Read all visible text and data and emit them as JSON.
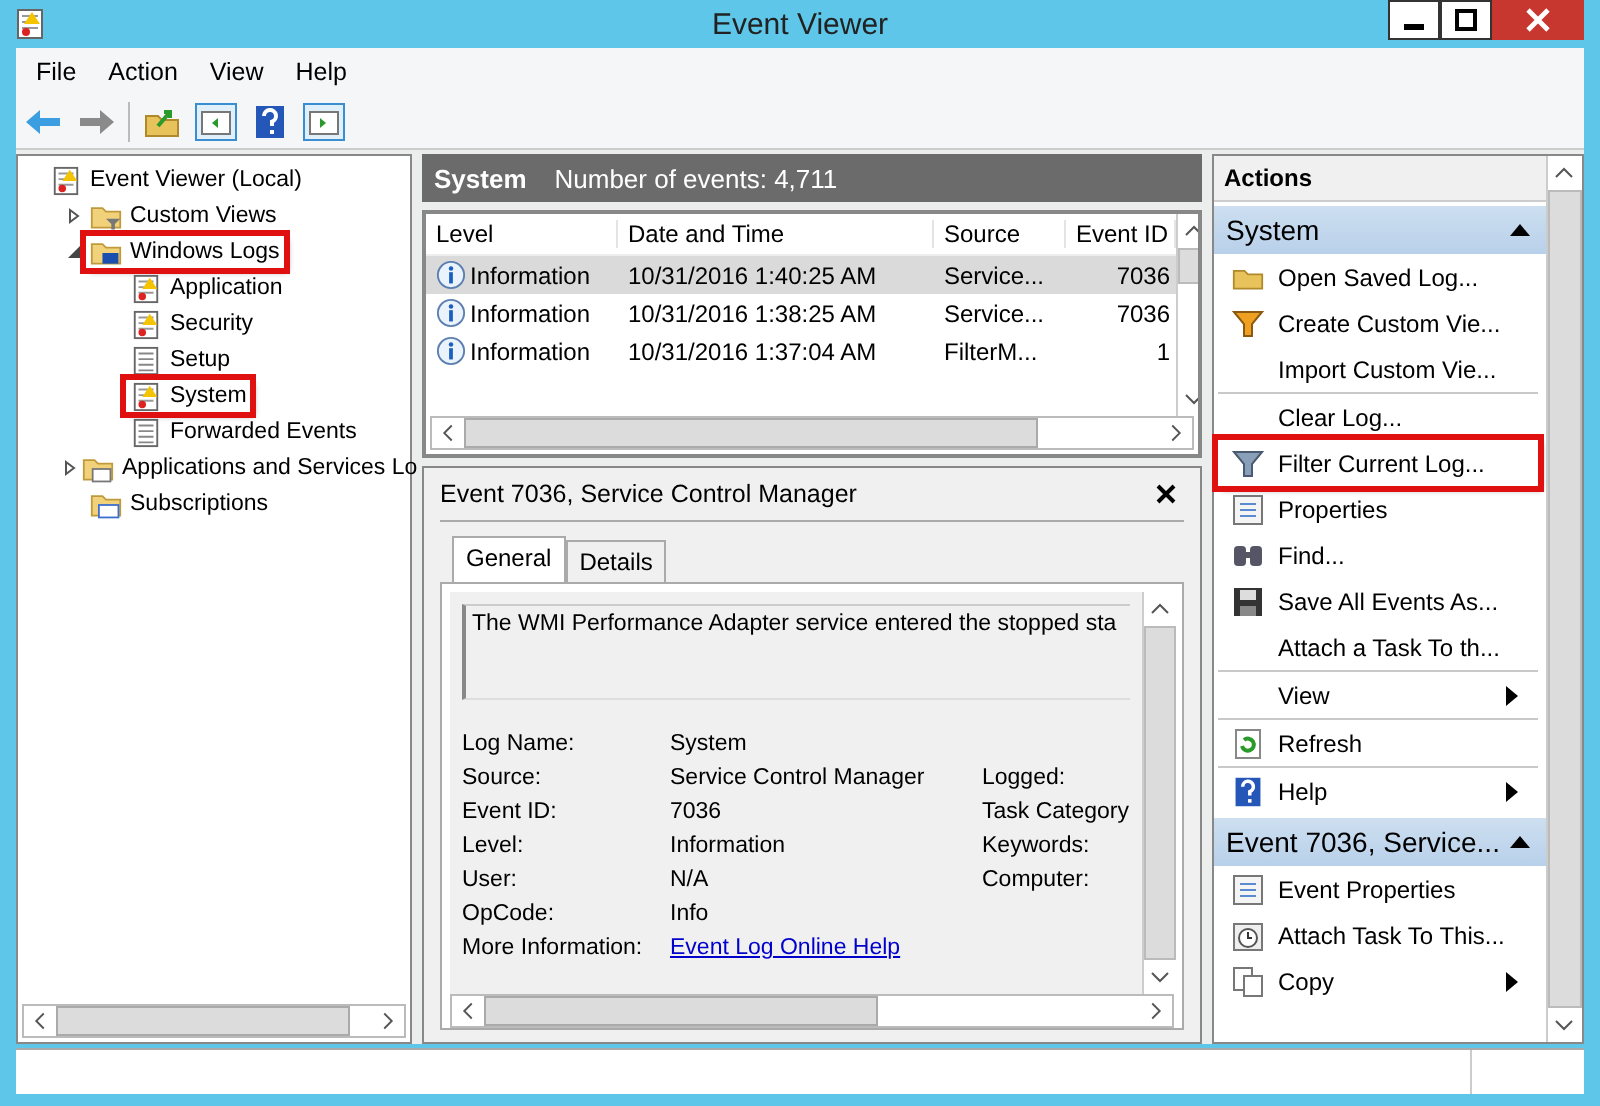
{
  "window": {
    "title": "Event Viewer"
  },
  "menu": [
    "File",
    "Action",
    "View",
    "Help"
  ],
  "tree": [
    {
      "label": "Event Viewer (Local)",
      "kind": "root",
      "highlighted": false,
      "children": [
        {
          "label": "Custom Views",
          "kind": "filter-folder",
          "expanded": false,
          "highlighted": false
        },
        {
          "label": "Windows Logs",
          "kind": "logs-folder",
          "expanded": true,
          "highlighted": true,
          "children": [
            {
              "label": "Application",
              "kind": "log",
              "highlighted": false
            },
            {
              "label": "Security",
              "kind": "log",
              "highlighted": false
            },
            {
              "label": "Setup",
              "kind": "plain-log",
              "highlighted": false
            },
            {
              "label": "System",
              "kind": "log",
              "highlighted": true
            },
            {
              "label": "Forwarded Events",
              "kind": "plain-log",
              "highlighted": false
            }
          ]
        },
        {
          "label": "Applications and Services Lo",
          "kind": "folder",
          "expanded": false,
          "highlighted": false
        },
        {
          "label": "Subscriptions",
          "kind": "subscriptions",
          "highlighted": false
        }
      ]
    }
  ],
  "log_header": {
    "title": "System",
    "count": "Number of events: 4,711"
  },
  "events": {
    "columns": [
      "Level",
      "Date and Time",
      "Source",
      "Event ID"
    ],
    "rows": [
      {
        "level": "Information",
        "date": "10/31/2016 1:40:25 AM",
        "source": "Service...",
        "event_id": "7036",
        "selected": true
      },
      {
        "level": "Information",
        "date": "10/31/2016 1:38:25 AM",
        "source": "Service...",
        "event_id": "7036",
        "selected": false
      },
      {
        "level": "Information",
        "date": "10/31/2016 1:37:04 AM",
        "source": "FilterM...",
        "event_id": "1",
        "selected": false
      }
    ]
  },
  "detail": {
    "title": "Event 7036, Service Control Manager",
    "tabs": [
      {
        "label": "General",
        "selected": true
      },
      {
        "label": "Details",
        "selected": false
      }
    ],
    "description": "The WMI Performance Adapter service entered the stopped sta",
    "fields": [
      {
        "label": "Log Name:",
        "value": "System"
      },
      {
        "label": "Source:",
        "value": "Service Control Manager"
      },
      {
        "label": "Event ID:",
        "value": "7036"
      },
      {
        "label": "Level:",
        "value": "Information"
      },
      {
        "label": "User:",
        "value": "N/A"
      },
      {
        "label": "OpCode:",
        "value": "Info"
      }
    ],
    "right_labels": [
      "Logged:",
      "Task Category",
      "Keywords:",
      "Computer:"
    ],
    "more_info": {
      "label": "More Information:",
      "link": "Event Log Online Help"
    }
  },
  "actions": {
    "title": "Actions",
    "sections": [
      {
        "title": "System",
        "expanded": true,
        "items": [
          {
            "label": "Open Saved Log...",
            "kind": "open",
            "submenu": false,
            "divider_before": false,
            "highlighted": false
          },
          {
            "label": "Create Custom Vie...",
            "kind": "filter",
            "submenu": false,
            "divider_before": false,
            "highlighted": false
          },
          {
            "label": "Import Custom Vie...",
            "kind": "plain",
            "submenu": false,
            "divider_before": false,
            "highlighted": false
          },
          {
            "label": "Clear Log...",
            "kind": "plain",
            "submenu": false,
            "divider_before": true,
            "highlighted": false
          },
          {
            "label": "Filter Current Log...",
            "kind": "funnel",
            "submenu": false,
            "divider_before": false,
            "highlighted": true
          },
          {
            "label": "Properties",
            "kind": "properties",
            "submenu": false,
            "divider_before": false,
            "highlighted": false
          },
          {
            "label": "Find...",
            "kind": "find",
            "submenu": false,
            "divider_before": false,
            "highlighted": false
          },
          {
            "label": "Save All Events As...",
            "kind": "save",
            "submenu": false,
            "divider_before": false,
            "highlighted": false
          },
          {
            "label": "Attach a Task To th...",
            "kind": "plain",
            "submenu": false,
            "divider_before": false,
            "highlighted": false
          },
          {
            "label": "View",
            "kind": "plain",
            "submenu": true,
            "divider_before": true,
            "highlighted": false
          },
          {
            "label": "Refresh",
            "kind": "refresh",
            "submenu": false,
            "divider_before": true,
            "highlighted": false
          },
          {
            "label": "Help",
            "kind": "help",
            "submenu": true,
            "divider_before": true,
            "highlighted": false
          }
        ]
      },
      {
        "title": "Event 7036, Service...",
        "expanded": true,
        "items": [
          {
            "label": "Event Properties",
            "kind": "properties",
            "submenu": false,
            "divider_before": false,
            "highlighted": false
          },
          {
            "label": "Attach Task To This...",
            "kind": "task",
            "submenu": false,
            "divider_before": false,
            "highlighted": false
          },
          {
            "label": "Copy",
            "kind": "copy",
            "submenu": true,
            "divider_before": false,
            "highlighted": false
          }
        ]
      }
    ]
  }
}
